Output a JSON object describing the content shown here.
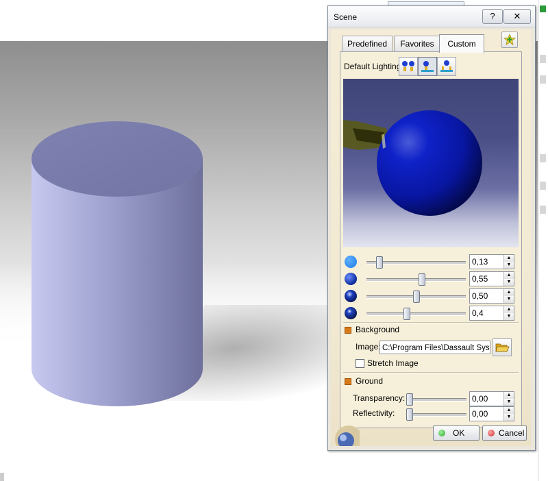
{
  "dialog": {
    "title": "Scene",
    "help_glyph": "?",
    "close_glyph": "✕"
  },
  "tabs": [
    {
      "label": "Predefined"
    },
    {
      "label": "Favorites"
    },
    {
      "label": "Custom",
      "active": true
    }
  ],
  "lighting": {
    "label": "Default Lighting:",
    "buttons": [
      "two-lights-icon",
      "single-light-icon",
      "multi-light-icon"
    ]
  },
  "sliders": [
    {
      "icon": "ambient-sphere-icon",
      "value": "0,13",
      "level": 0.13
    },
    {
      "icon": "diffuse-sphere-icon",
      "value": "0,55",
      "level": 0.55
    },
    {
      "icon": "specular-sphere-icon",
      "value": "0,50",
      "level": 0.5
    },
    {
      "icon": "shininess-sphere-icon",
      "value": "0,4",
      "level": 0.4
    }
  ],
  "background": {
    "heading": "Background",
    "image_label": "Image:",
    "image_value": "C:\\Program Files\\Dassault Systemes",
    "stretch_label": "Stretch Image",
    "stretch_checked": false
  },
  "ground": {
    "heading": "Ground",
    "transparency_label": "Transparency:",
    "transparency_value": "0,00",
    "transparency_level": 0.0,
    "reflectivity_label": "Reflectivity:",
    "reflectivity_value": "0,00",
    "reflectivity_level": 0.0
  },
  "buttons": {
    "ok_label": "OK",
    "cancel_label": "Cancel"
  },
  "colors": {
    "ok_dot": "#2fa82f",
    "cancel_dot": "#d02a2a",
    "section_square": "#d87a18",
    "cylinder": "#8e90c2"
  }
}
